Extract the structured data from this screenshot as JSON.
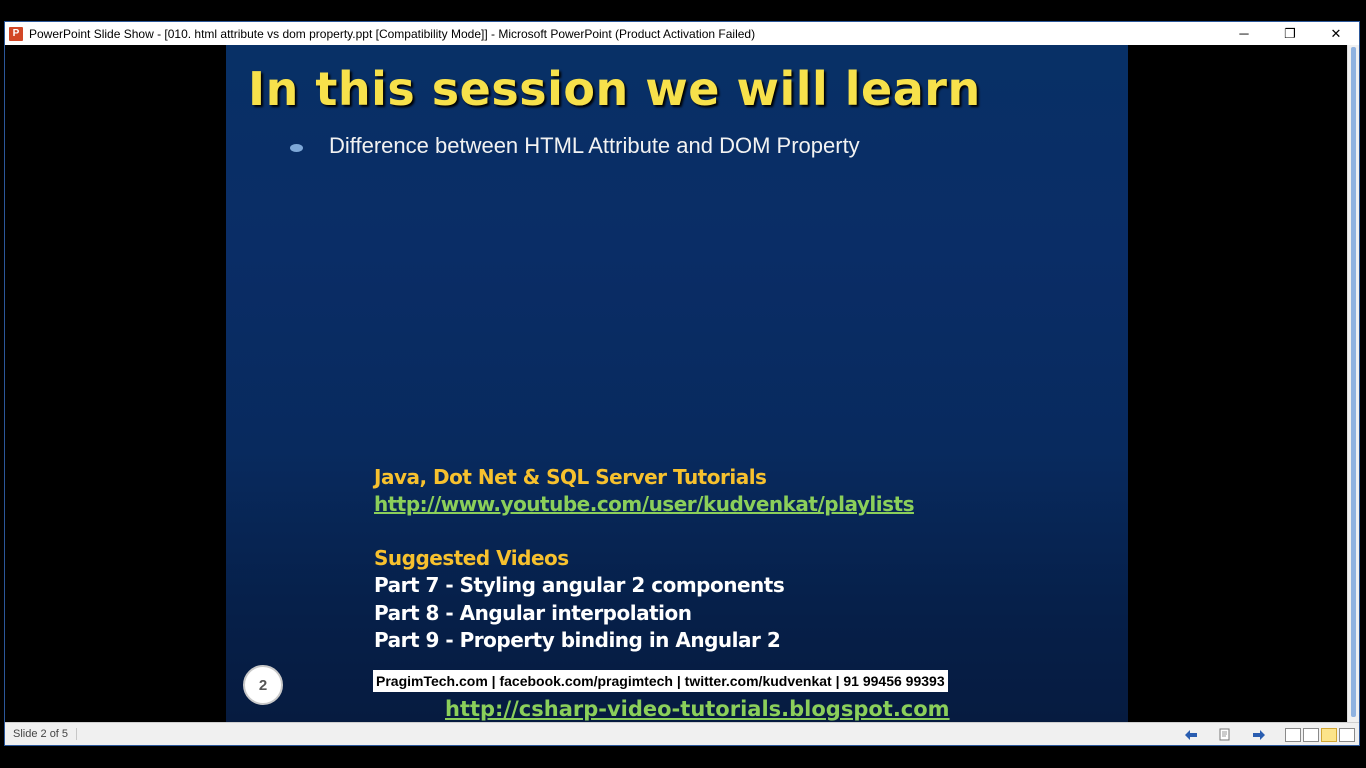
{
  "window": {
    "app_icon": "P",
    "title": "PowerPoint Slide Show - [010. html attribute vs dom property.ppt [Compatibility Mode]] - Microsoft PowerPoint (Product Activation Failed)",
    "minimize": "─",
    "restore": "❐",
    "close": "✕"
  },
  "slide": {
    "title": "In this session we will learn",
    "bullets": [
      "Difference between HTML Attribute and DOM Property"
    ],
    "tutorials_heading": "Java, Dot Net & SQL Server Tutorials",
    "playlist_link": "http://www.youtube.com/user/kudvenkat/playlists",
    "suggested_heading": "Suggested Videos",
    "videos": [
      "Part 7 - Styling angular 2 components",
      "Part 8 - Angular interpolation",
      "Part 9 - Property binding in Angular 2"
    ],
    "slide_number": "2",
    "contact": "PragimTech.com | facebook.com/pragimtech  | twitter.com/kudvenkat  | 91 99456 99393",
    "blog_link": "http://csharp-video-tutorials.blogspot.com"
  },
  "statusbar": {
    "slide_info": "Slide 2 of 5",
    "icons": [
      "previous-arrow-icon",
      "notes-icon",
      "next-arrow-icon",
      "normal-view-icon",
      "slide-sorter-icon",
      "reading-view-icon",
      "slide-show-icon"
    ]
  },
  "colors": {
    "title_yellow": "#f7e14b",
    "heading_gold": "#f7c12e",
    "link_green": "#8bcf5a",
    "slide_blue": "#0a2d66"
  }
}
